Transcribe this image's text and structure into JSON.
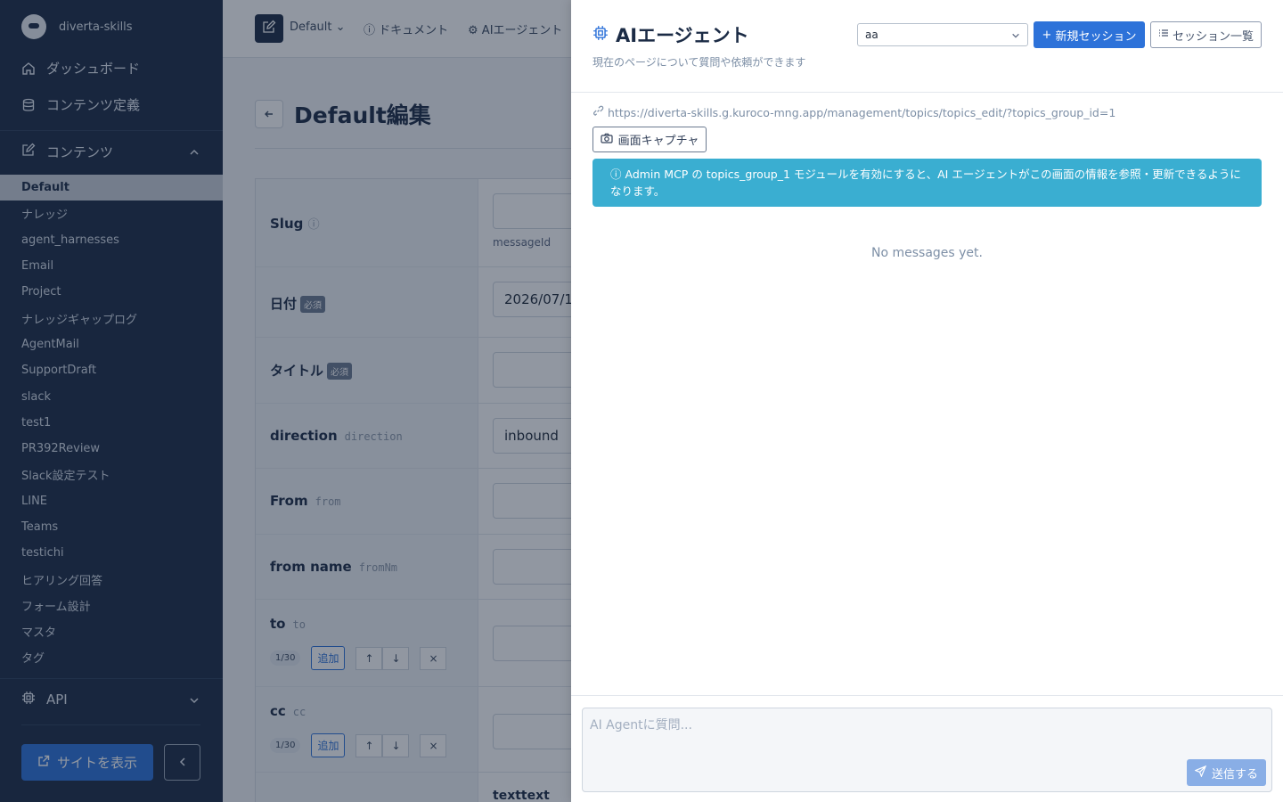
{
  "sidebar": {
    "brand": "diverta-skills",
    "nav": [
      {
        "label": "ダッシュボード",
        "icon": "home-icon"
      },
      {
        "label": "コンテンツ定義",
        "icon": "database-icon"
      }
    ],
    "section_label": "コンテンツ",
    "items": [
      {
        "label": "Default",
        "active": true
      },
      {
        "label": "ナレッジ"
      },
      {
        "label": "agent_harnesses"
      },
      {
        "label": "Email"
      },
      {
        "label": "Project"
      },
      {
        "label": "ナレッジギャップログ"
      },
      {
        "label": "AgentMail"
      },
      {
        "label": "SupportDraft"
      },
      {
        "label": "slack"
      },
      {
        "label": "test1"
      },
      {
        "label": "PR392Review"
      },
      {
        "label": "Slack設定テスト"
      },
      {
        "label": "LINE"
      },
      {
        "label": "Teams"
      },
      {
        "label": "testichi"
      },
      {
        "label": "ヒアリング回答"
      },
      {
        "label": "フォーム設計"
      },
      {
        "label": "マスタ"
      },
      {
        "label": "タグ"
      }
    ],
    "api_label": "API",
    "site_button": "サイトを表示"
  },
  "topbar": {
    "default_label": "Default",
    "doc_label": "ドキュメント",
    "agent_label": "AIエージェント"
  },
  "page": {
    "title": "Default編集",
    "required_badge": "必須",
    "fields": {
      "slug": {
        "label": "Slug",
        "hint": "messageId"
      },
      "date": {
        "label": "日付",
        "value": "2026/07/1"
      },
      "title": {
        "label": "タイトル"
      },
      "direction": {
        "label": "direction",
        "key": "direction",
        "value": "inbound"
      },
      "from": {
        "label": "From",
        "key": "from"
      },
      "from_name": {
        "label": "from name",
        "key": "fromNm"
      },
      "to": {
        "label": "to",
        "key": "to",
        "count": "1/30",
        "add": "追加"
      },
      "cc": {
        "label": "cc",
        "key": "cc",
        "count": "1/30",
        "add": "追加"
      },
      "text": {
        "label": "text",
        "key": "text"
      }
    }
  },
  "agent": {
    "title": "AIエージェント",
    "subtitle": "現在のページについて質問や依頼ができます",
    "session_value": "aa",
    "new_session": "新規セッション",
    "session_list": "セッション一覧",
    "url": "https://diverta-skills.g.kuroco-mng.app/management/topics/topics_edit/?topics_group_id=1",
    "capture": "画面キャプチャ",
    "alert": "Admin MCP の topics_group_1 モジュールを有効にすると、AI エージェントがこの画面の情報を参照・更新できるようになります。",
    "empty": "No messages yet.",
    "input_placeholder": "AI Agentに質問...",
    "send": "送信する"
  },
  "colors": {
    "sidebar_bg": "#1b2b45",
    "accent": "#2d72d9",
    "alert_bg": "#3aaed1"
  }
}
